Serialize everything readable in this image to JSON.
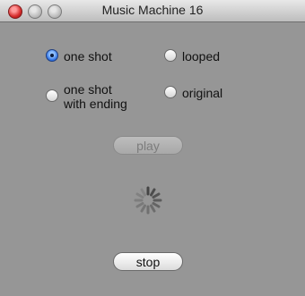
{
  "window": {
    "title": "Music Machine 16"
  },
  "modes": [
    {
      "label": "one shot",
      "selected": true
    },
    {
      "label": "looped",
      "selected": false
    },
    {
      "label": "one shot\nwith ending",
      "selected": false
    },
    {
      "label": "original",
      "selected": false
    }
  ],
  "buttons": {
    "play": "play",
    "stop": "stop"
  },
  "colors": {
    "accent": "#2b6de0",
    "background": "#969696"
  },
  "icons": {
    "close": "close-icon",
    "minimize": "minimize-icon",
    "zoom": "zoom-icon",
    "spinner": "spinner-icon"
  }
}
